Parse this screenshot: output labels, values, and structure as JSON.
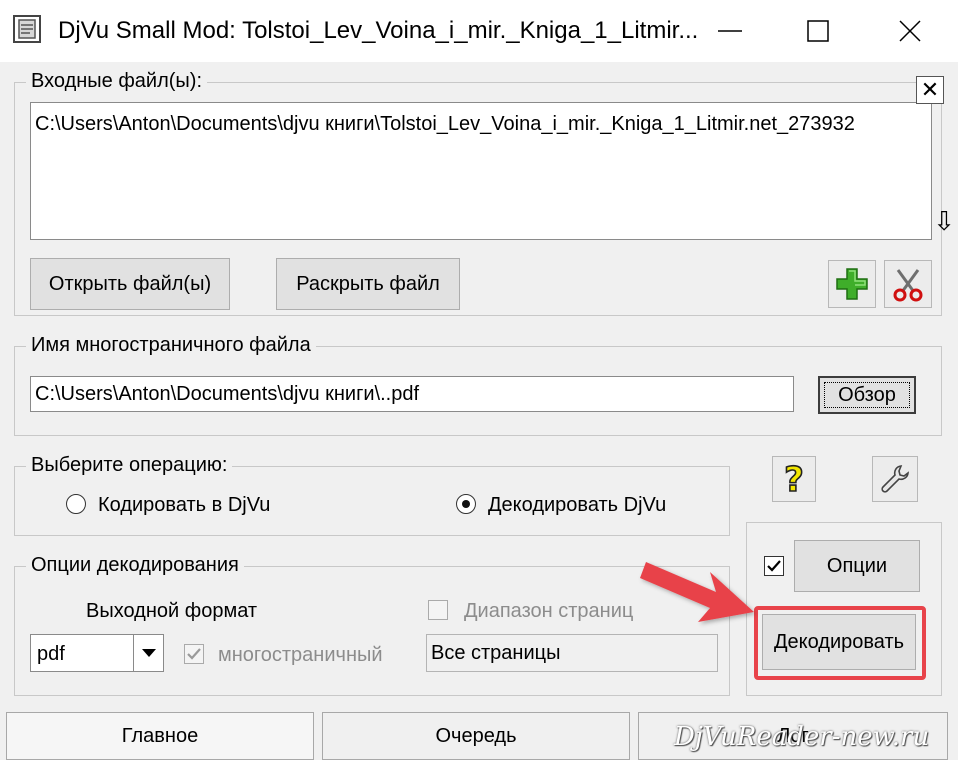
{
  "window": {
    "title": "DjVu Small Mod: Tolstoi_Lev_Voina_i_mir._Kniga_1_Litmir..."
  },
  "input_files": {
    "label": "Входные файл(ы):",
    "items": [
      "C:\\Users\\Anton\\Documents\\djvu книги\\Tolstoi_Lev_Voina_i_mir._Kniga_1_Litmir.net_273932"
    ],
    "open_button": "Открыть файл(ы)",
    "expand_button": "Раскрыть файл",
    "clear_glyph": "✕",
    "scroll_glyph": "⇩"
  },
  "output_file": {
    "label": "Имя многостраничного файла",
    "value": "C:\\Users\\Anton\\Documents\\djvu книги\\..pdf",
    "browse_button": "Обзор"
  },
  "operation": {
    "label": "Выберите операцию:",
    "encode_label": "Кодировать в DjVu",
    "decode_label": "Декодировать DjVu",
    "selected": "decode"
  },
  "decode_options": {
    "label": "Опции декодирования",
    "format_label": "Выходной формат",
    "format_value": "pdf",
    "multipage_label": "многостраничный",
    "multipage_checked": true,
    "page_range_label": "Диапазон страниц",
    "page_range_checked": false,
    "page_range_value": "Все страницы"
  },
  "actions": {
    "options_button": "Опции",
    "options_checked": true,
    "decode_button": "Декодировать"
  },
  "tabs": [
    "Главное",
    "Очередь",
    "Лог"
  ],
  "watermark": "DjVuReader-new.ru",
  "colors": {
    "highlight": "#e8434a",
    "arrow": "#e8434a",
    "plus_icon": "#3fae2a",
    "help_icon": "#f2e600"
  },
  "icons": {
    "help": "?"
  }
}
